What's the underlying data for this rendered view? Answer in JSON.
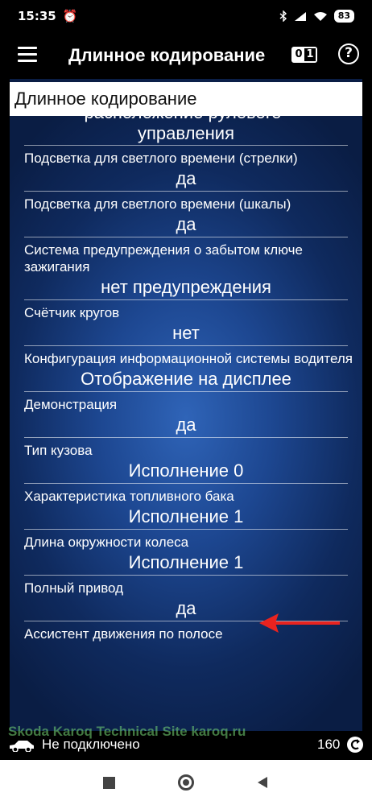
{
  "status_bar": {
    "time": "15:35",
    "battery": "83"
  },
  "header": {
    "title": "Длинное кодирование",
    "toggle_zero": "0",
    "toggle_one": "1",
    "help": "?"
  },
  "section_title": "Длинное кодирование",
  "items": [
    {
      "label": "расположение рулевого",
      "value": "управления"
    },
    {
      "label": "Подсветка для светлого времени (стрелки)",
      "value": "да"
    },
    {
      "label": "Подсветка для светлого времени (шкалы)",
      "value": "да"
    },
    {
      "label": "Система предупреждения о забытом ключе зажигания",
      "value": "нет предупреждения"
    },
    {
      "label": "Счётчик кругов",
      "value": "нет"
    },
    {
      "label": "Конфигурация информационной системы водителя",
      "value": "Отображение на дисплее"
    },
    {
      "label": "Демонстрация",
      "value": "да"
    },
    {
      "label": "Тип кузова",
      "value": "Исполнение 0"
    },
    {
      "label": "Характеристика топливного бака",
      "value": "Исполнение 1"
    },
    {
      "label": "Длина окружности колеса",
      "value": "Исполнение 1"
    },
    {
      "label": "Полный привод",
      "value": "да"
    },
    {
      "label": "Ассистент движения по полосе",
      "value": ""
    }
  ],
  "bottom": {
    "connection": "Не подключено",
    "watermark": "Skoda Karoq Technical Site karoq.ru",
    "counter": "160"
  },
  "colors": {
    "accent_arrow": "#e8231f",
    "background_center": "#2f64b8",
    "background_edge": "#0a1d44"
  }
}
